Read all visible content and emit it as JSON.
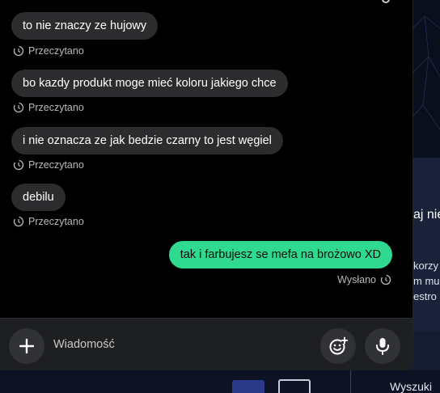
{
  "messages": [
    {
      "direction": "in",
      "text": "to nie znaczy ze hujowy",
      "status": "Przeczytano"
    },
    {
      "direction": "in",
      "text": "bo kazdy produkt moge mieć koloru jakiego chce",
      "status": "Przeczytano"
    },
    {
      "direction": "in",
      "text": "i nie oznacza ze jak bedzie czarny to jest węgiel",
      "status": "Przeczytano"
    },
    {
      "direction": "in",
      "text": "debilu",
      "status": "Przeczytano"
    },
    {
      "direction": "out",
      "text": "tak i farbujesz se mefa na brożowo XD",
      "status": "Wysłano"
    }
  ],
  "composer": {
    "placeholder": "Wiadomość"
  },
  "background": {
    "heading": "aj nie",
    "lines": [
      "korzy",
      "m mu",
      "estro"
    ],
    "search_label": "Wyszuki"
  },
  "colors": {
    "incoming_bubble": "#2c2c2e",
    "outgoing_bubble": "#2fd98f",
    "chat_background": "#000000",
    "composer_background": "#1e1f21"
  }
}
